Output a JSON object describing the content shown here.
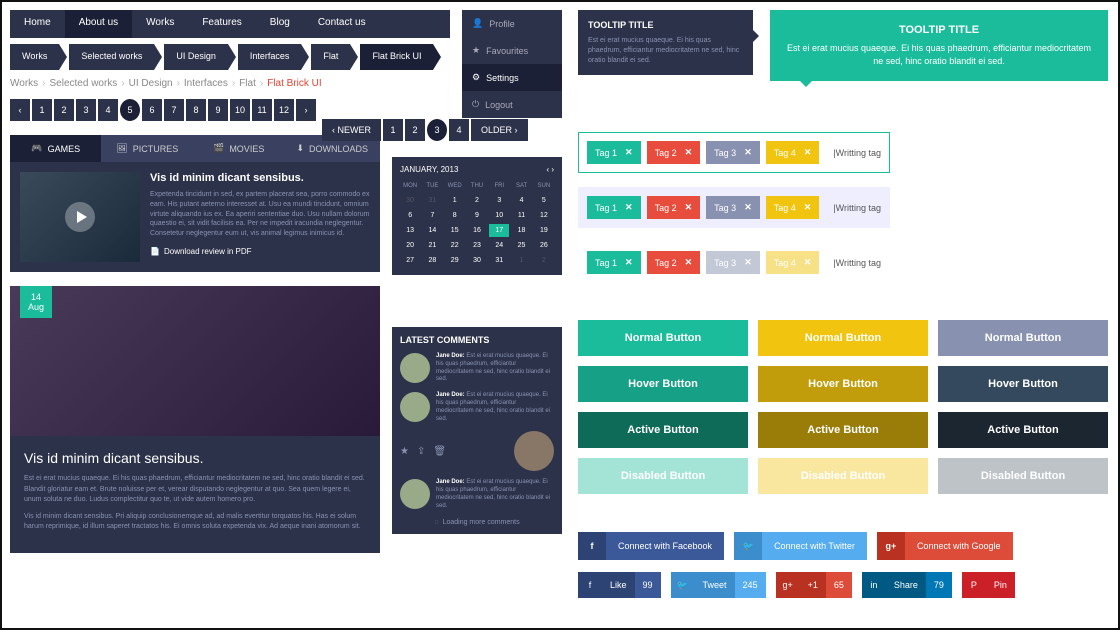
{
  "nav": [
    "Home",
    "About us",
    "Works",
    "Features",
    "Blog",
    "Contact us"
  ],
  "nav_active": 1,
  "bc": [
    "Works",
    "Selected works",
    "UI Design",
    "Interfaces",
    "Flat",
    "Flat Brick UI"
  ],
  "bc_active": 5,
  "bc2": [
    "Works",
    "Selected works",
    "UI Design",
    "Interfaces",
    "Flat",
    "Flat Brick UI"
  ],
  "pager": [
    "‹",
    "1",
    "2",
    "3",
    "4",
    "5",
    "6",
    "7",
    "8",
    "9",
    "10",
    "11",
    "12",
    "›"
  ],
  "pager_active": 5,
  "pager2": {
    "newer": "‹ NEWER",
    "pages": [
      "1",
      "2",
      "3",
      "4"
    ],
    "older": "OLDER ›",
    "active": 2
  },
  "tabs": [
    {
      "icon": "🎮",
      "label": "GAMES"
    },
    {
      "icon": "🖼",
      "label": "PICTURES"
    },
    {
      "icon": "🎬",
      "label": "MOVIES"
    },
    {
      "icon": "⬇",
      "label": "DOWNLOADS"
    }
  ],
  "tabs_active": 0,
  "article": {
    "title": "Vis id minim dicant sensibus.",
    "body": "Expetenda tincidunt in sed, ex partem placerat sea, porro commodo ex eam. His putant aeterno interesset at. Usu ea mundi tincidunt, omnium virtute aliquando ius ex. Ea aperiri sententiae duo. Usu nullam dolorum quaestio ei, sit vidit facilisis ea. Per ne impedit iracundia neglegentur. Consetetur neglegentur eum ut, vis animal legimus inimicus id.",
    "download": "Download review in PDF"
  },
  "dropdown": [
    {
      "icon": "👤",
      "label": "Profile"
    },
    {
      "icon": "★",
      "label": "Favourites"
    },
    {
      "icon": "⚙",
      "label": "Settings"
    },
    {
      "icon": "⏻",
      "label": "Logout"
    }
  ],
  "dropdown_active": 2,
  "tooltip": {
    "title": "TOOLTIP TITLE",
    "body": "Est ei erat mucius quaeque. Ei his quas phaedrum, efficiantur mediocritatem ne sed, hinc oratio blandit ei sed."
  },
  "calendar": {
    "title": "JANUARY, 2013",
    "dow": [
      "MON",
      "TUE",
      "WED",
      "THU",
      "FRI",
      "SAT",
      "SUN"
    ],
    "current": 17
  },
  "post": {
    "date_day": "14",
    "date_month": "Aug",
    "title": "Vis id minim dicant sensibus.",
    "p1": "Est ei erat mucius quaeque. Ei his quas phaedrum, efficiantur mediocritatem ne sed, hinc oratio blandit ei sed. Blandit gloriatur eam et. Brute noluisse per et, verear disputando neglegentur at quo. Sea quem legere ei, unum soluta ne duo. Ludus complectitur quo te, ut vide autem homero pro.",
    "p2": "Vis id minim dicant sensibus. Pri aliquip conclusionemque ad, ad malis evertitur torquatos his. Has ei solum harum reprimique, id illum saperet tractatos his. Ei omnis soluta expetenda vix. Ad aeque inani atomorum sit."
  },
  "comments": {
    "title": "LATEST COMMENTS",
    "author": "Jane Doe:",
    "text": "Est ei erat mucius quaeque. Ei his quas phaedrum, efficiantur mediocritatem ne sed, hinc oratio blandit ei sed.",
    "loading": "Loading more comments"
  },
  "tags": [
    "Tag 1",
    "Tag 2",
    "Tag 3",
    "Tag 4"
  ],
  "tag_input": "|Writting tag",
  "buttons": {
    "normal": "Normal Button",
    "hover": "Hover Button",
    "active": "Active Button",
    "disabled": "Disabled Button"
  },
  "social": {
    "fb": "Connect with Facebook",
    "tw": "Connect with Twitter",
    "gp": "Connect with Google"
  },
  "counts": {
    "like": {
      "label": "Like",
      "n": "99"
    },
    "tweet": {
      "label": "Tweet",
      "n": "245"
    },
    "plus": {
      "label": "+1",
      "n": "65"
    },
    "share": {
      "label": "Share",
      "n": "79"
    },
    "pin": {
      "label": "Pin"
    }
  }
}
